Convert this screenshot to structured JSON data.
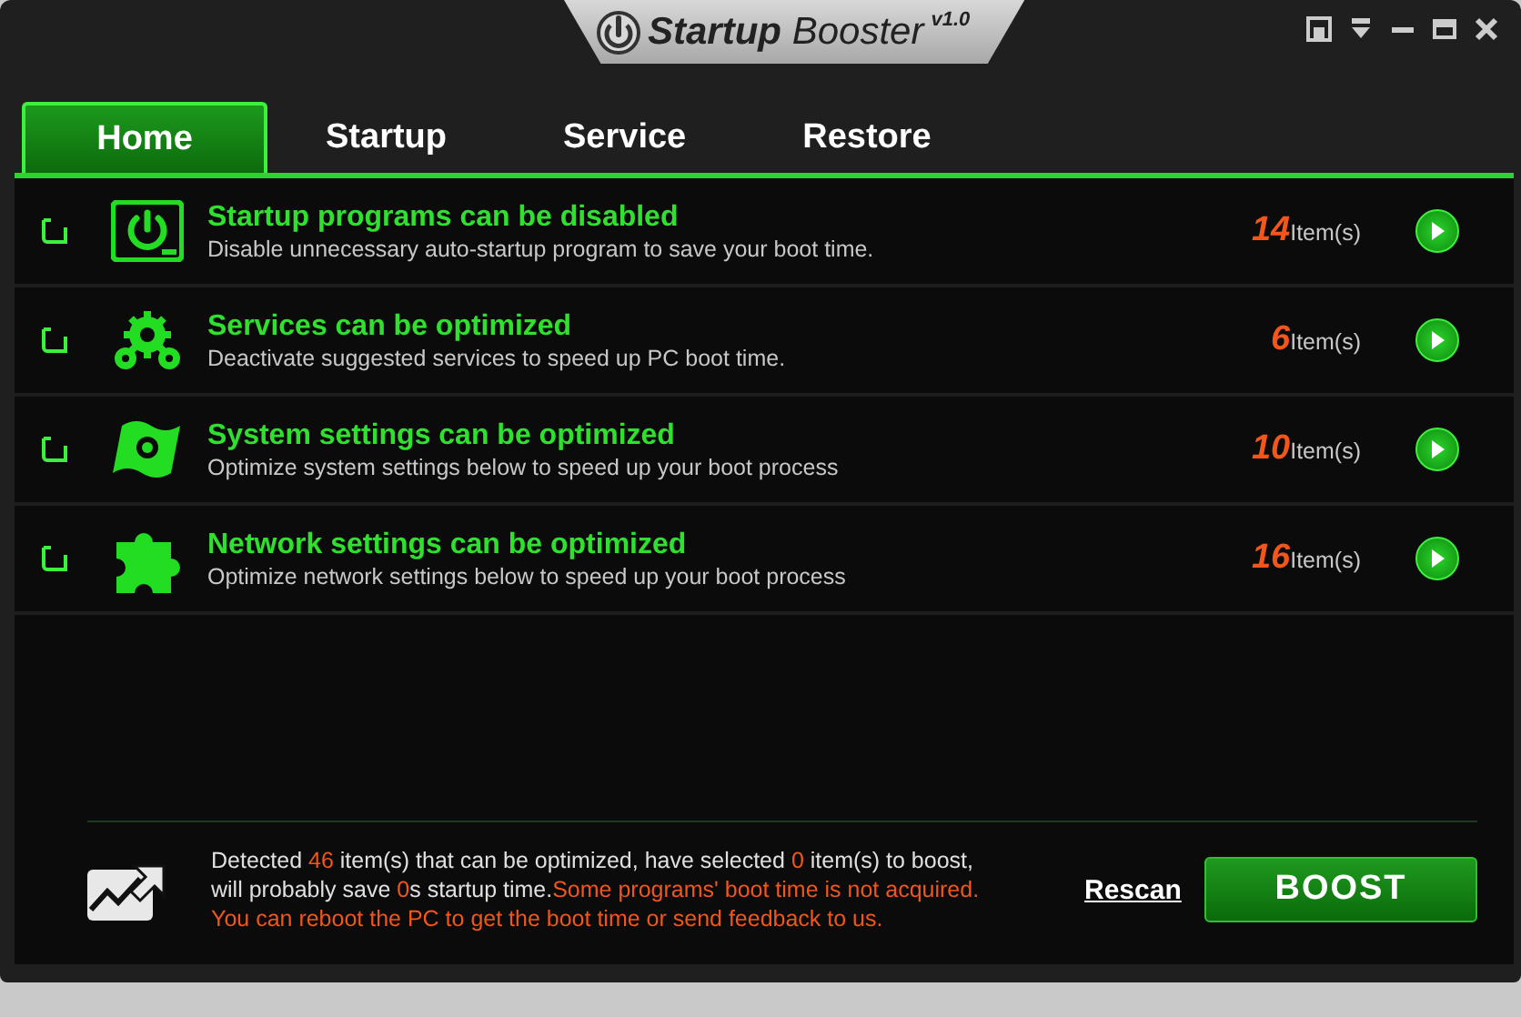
{
  "window": {
    "title": "**Startup** Booster",
    "version": "v1.0"
  },
  "tabs": [
    {
      "label": "Home",
      "selected": true
    },
    {
      "label": "Startup",
      "selected": false
    },
    {
      "label": "Service",
      "selected": false
    },
    {
      "label": "Restore",
      "selected": false
    }
  ],
  "items": [
    {
      "kind": "startup",
      "title": "Startup programs can be disabled",
      "description": "Disable unnecessary auto-startup program to save your boot time.",
      "count": "14",
      "unit": "Item(s)",
      "checked": false
    },
    {
      "kind": "services",
      "title": "Services can be optimized",
      "description": "Deactivate suggested services to speed up PC boot time.",
      "count": "6",
      "unit": "Item(s)",
      "checked": false
    },
    {
      "kind": "system",
      "title": "System settings can be optimized",
      "description": "Optimize system settings below to speed up your boot process",
      "count": "10",
      "unit": "Item(s)",
      "checked": false
    },
    {
      "kind": "network",
      "title": "Network settings can be optimized",
      "description": "Optimize network settings below to speed up your boot process",
      "count": "16",
      "unit": "Item(s)",
      "checked": false
    }
  ],
  "footer": {
    "message": [
      [
        {
          "text": "Detected ",
          "kind": "plain"
        },
        {
          "text": "46",
          "kind": "accent"
        },
        {
          "text": " item(s) that can be optimized, have selected ",
          "kind": "plain"
        },
        {
          "text": "0",
          "kind": "accent"
        },
        {
          "text": " item(s) to boost,",
          "kind": "plain"
        }
      ],
      [
        {
          "text": "will probably save ",
          "kind": "plain"
        },
        {
          "text": "0",
          "kind": "accent"
        },
        {
          "text": "s startup time.",
          "kind": "plain"
        },
        {
          "text": "Some programs' boot time is not acquired.",
          "kind": "accent"
        }
      ],
      [
        {
          "text": "You can reboot the PC to get the boot time or send feedback to us.",
          "kind": "accent"
        }
      ]
    ],
    "rescan": "Rescan",
    "boost": "BOOST"
  }
}
